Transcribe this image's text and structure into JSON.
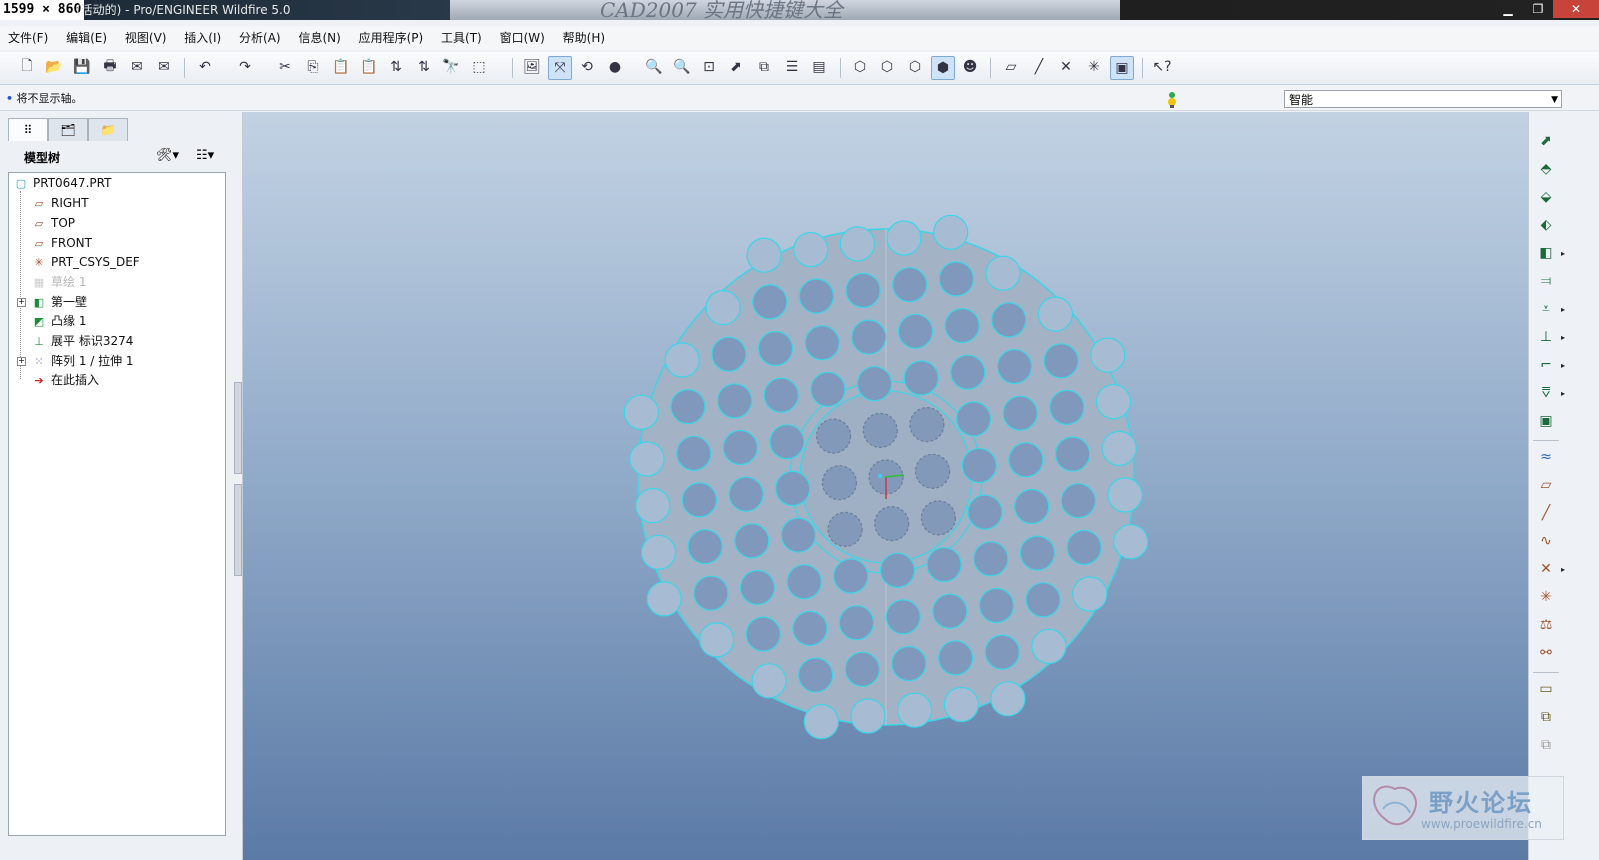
{
  "window": {
    "dimension_label": "1599 × 860",
    "title": "(活动的) - Pro/ENGINEER Wildfire 5.0",
    "background_text": "CAD2007 实用快捷键大全"
  },
  "menu": [
    "文件(F)",
    "编辑(E)",
    "视图(V)",
    "插入(I)",
    "分析(A)",
    "信息(N)",
    "应用程序(P)",
    "工具(T)",
    "窗口(W)",
    "帮助(H)"
  ],
  "status": {
    "message": "将不显示轴。",
    "filter_value": "智能"
  },
  "left_panel": {
    "header": "模型树",
    "tree": [
      {
        "label": "PRT0647.PRT",
        "icon": "part-icon",
        "dim": false,
        "expandable": false
      },
      {
        "label": "RIGHT",
        "icon": "datum-plane-icon",
        "dim": false,
        "expandable": false
      },
      {
        "label": "TOP",
        "icon": "datum-plane-icon",
        "dim": false,
        "expandable": false
      },
      {
        "label": "FRONT",
        "icon": "datum-plane-icon",
        "dim": false,
        "expandable": false
      },
      {
        "label": "PRT_CSYS_DEF",
        "icon": "csys-icon",
        "dim": false,
        "expandable": false
      },
      {
        "label": "草绘 1",
        "icon": "sketch-icon",
        "dim": true,
        "expandable": false
      },
      {
        "label": "第一壁",
        "icon": "first-wall-icon",
        "dim": false,
        "expandable": true
      },
      {
        "label": "凸缘 1",
        "icon": "flange-icon",
        "dim": false,
        "expandable": false
      },
      {
        "label": "展平 标识3274",
        "icon": "unbend-icon",
        "dim": false,
        "expandable": false
      },
      {
        "label": "阵列 1 / 拉伸 1",
        "icon": "pattern-icon",
        "dim": false,
        "expandable": true
      },
      {
        "label": "在此插入",
        "icon": "insert-here-arrow-icon",
        "dim": false,
        "expandable": false
      }
    ]
  },
  "watermark": {
    "name": "野火论坛",
    "url": "www.proewildfire.cn"
  },
  "colors": {
    "edge": "#39d6e8",
    "part_fill": "#a3b2c4",
    "hole_fill": "#7f98bb",
    "accent": "#1f52d0"
  }
}
